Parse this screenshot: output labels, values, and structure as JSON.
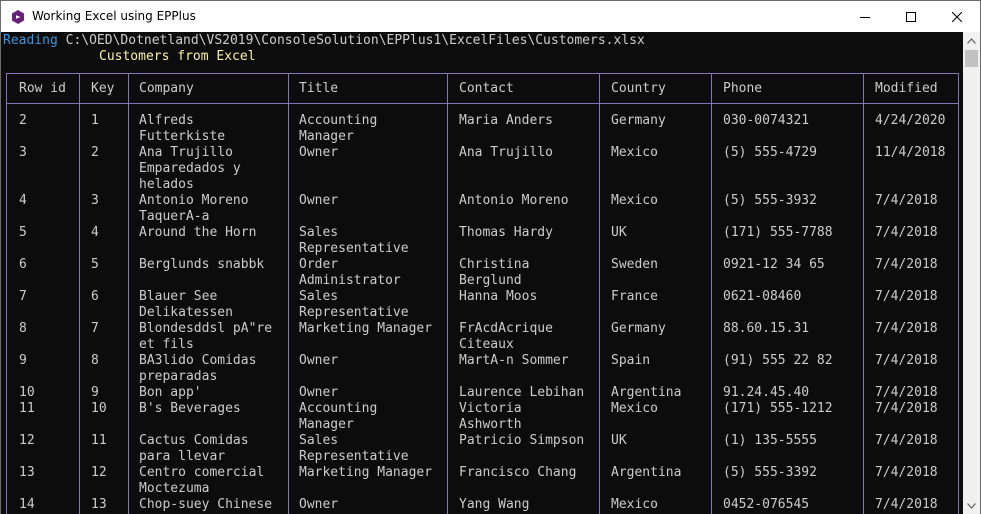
{
  "window": {
    "title": "Working Excel using EPPlus"
  },
  "console": {
    "reading_label": "Reading",
    "reading_path": "C:\\OED\\Dotnetland\\VS2019\\ConsoleSolution\\EPPlus1\\ExcelFiles\\Customers.xlsx",
    "subtitle": "Customers from Excel"
  },
  "table": {
    "headers": [
      "Row id",
      "Key",
      "Company",
      "Title",
      "Contact",
      "Country",
      "Phone",
      "Modified"
    ],
    "rows": [
      {
        "row": "2",
        "key": "1",
        "company": [
          "Alfreds",
          "Futterkiste"
        ],
        "title": [
          "Accounting",
          "Manager"
        ],
        "contact": [
          "Maria Anders"
        ],
        "country": "Germany",
        "phone": "030-0074321",
        "modified": "4/24/2020"
      },
      {
        "row": "3",
        "key": "2",
        "company": [
          "Ana Trujillo",
          "Emparedados y",
          "helados"
        ],
        "title": [
          "Owner"
        ],
        "contact": [
          "Ana Trujillo"
        ],
        "country": "Mexico",
        "phone": "(5) 555-4729",
        "modified": "11/4/2018"
      },
      {
        "row": "4",
        "key": "3",
        "company": [
          "Antonio Moreno",
          "TaquerA-a"
        ],
        "title": [
          "Owner"
        ],
        "contact": [
          "Antonio Moreno"
        ],
        "country": "Mexico",
        "phone": "(5) 555-3932",
        "modified": "7/4/2018"
      },
      {
        "row": "5",
        "key": "4",
        "company": [
          "Around the Horn"
        ],
        "title": [
          "Sales",
          "Representative"
        ],
        "contact": [
          "Thomas Hardy"
        ],
        "country": "UK",
        "phone": "(171) 555-7788",
        "modified": "7/4/2018"
      },
      {
        "row": "6",
        "key": "5",
        "company": [
          "Berglunds snabbk"
        ],
        "title": [
          "Order",
          "Administrator"
        ],
        "contact": [
          "Christina",
          "Berglund"
        ],
        "country": "Sweden",
        "phone": "0921-12 34 65",
        "modified": "7/4/2018"
      },
      {
        "row": "7",
        "key": "6",
        "company": [
          "Blauer See",
          "Delikatessen"
        ],
        "title": [
          "Sales",
          "Representative"
        ],
        "contact": [
          "Hanna Moos"
        ],
        "country": "France",
        "phone": "0621-08460",
        "modified": "7/4/2018"
      },
      {
        "row": "8",
        "key": "7",
        "company": [
          "Blondesddsl pA\"re",
          "et fils"
        ],
        "title": [
          "Marketing Manager"
        ],
        "contact": [
          "FrAcdAcrique",
          "Citeaux"
        ],
        "country": "Germany",
        "phone": "88.60.15.31",
        "modified": "7/4/2018"
      },
      {
        "row": "9",
        "key": "8",
        "company": [
          "BA3lido Comidas",
          "preparadas"
        ],
        "title": [
          "Owner"
        ],
        "contact": [
          "MartA-n Sommer"
        ],
        "country": "Spain",
        "phone": "(91) 555 22 82",
        "modified": "7/4/2018"
      },
      {
        "row": "10",
        "key": "9",
        "company": [
          "Bon app'"
        ],
        "title": [
          "Owner"
        ],
        "contact": [
          "Laurence Lebihan"
        ],
        "country": "Argentina",
        "phone": "91.24.45.40",
        "modified": "7/4/2018"
      },
      {
        "row": "11",
        "key": "10",
        "company": [
          "B's Beverages"
        ],
        "title": [
          "Accounting",
          "Manager"
        ],
        "contact": [
          "Victoria",
          "Ashworth"
        ],
        "country": "Mexico",
        "phone": "(171) 555-1212",
        "modified": "7/4/2018"
      },
      {
        "row": "12",
        "key": "11",
        "company": [
          "Cactus Comidas",
          "para llevar"
        ],
        "title": [
          "Sales",
          "Representative"
        ],
        "contact": [
          "Patricio Simpson"
        ],
        "country": "UK",
        "phone": "(1) 135-5555",
        "modified": "7/4/2018"
      },
      {
        "row": "13",
        "key": "12",
        "company": [
          "Centro comercial",
          "Moctezuma"
        ],
        "title": [
          "Marketing Manager"
        ],
        "contact": [
          "Francisco Chang"
        ],
        "country": "Argentina",
        "phone": "(5) 555-3392",
        "modified": "7/4/2018"
      },
      {
        "row": "14",
        "key": "13",
        "company": [
          "Chop-suey Chinese"
        ],
        "title": [
          "Owner"
        ],
        "contact": [
          "Yang Wang"
        ],
        "country": "Mexico",
        "phone": "0452-076545",
        "modified": "7/4/2018"
      }
    ]
  },
  "colors": {
    "console_bg": "#0c0c0c",
    "console_text": "#cccccc",
    "reading_label": "#3a96dd",
    "subtitle": "#f9f1a5",
    "table_border": "#8672bb"
  },
  "icons": {
    "app": "visual-studio-icon",
    "minimize": "minimize-icon",
    "maximize": "maximize-icon",
    "close": "close-icon"
  }
}
